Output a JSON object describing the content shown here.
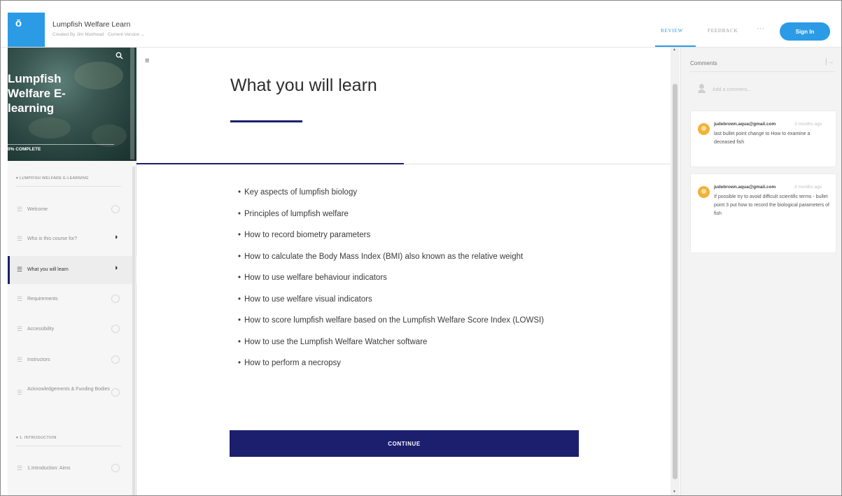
{
  "header": {
    "logo_glyph": "ō",
    "course_title": "Lumpfish Welfare Learn",
    "course_subtitle": "Created By Jim Muirhead · Current Version ⌄",
    "nav": {
      "review": "REVIEW",
      "feedback": "FEEDBACK",
      "more": "···"
    },
    "signin_label": "Sign In"
  },
  "sidebar": {
    "hero_title": "Lumpfish Welfare E-learning",
    "progress_label": "0% COMPLETE",
    "progress_percent": 0,
    "search_icon": "search-icon",
    "sections": [
      {
        "title": "▾ LUMPFISH WELFARE E-LEARNING",
        "items": [
          {
            "label": "Welcome",
            "status": "not-started"
          },
          {
            "label": "Who is this course for?",
            "status": "in-progress"
          },
          {
            "label": "What you will learn",
            "status": "in-progress",
            "active": true
          },
          {
            "label": "Requirements",
            "status": "not-started"
          },
          {
            "label": "Accessibility",
            "status": "not-started"
          },
          {
            "label": "Instructors",
            "status": "not-started"
          },
          {
            "label": "Acknowledgements & Funding Bodies",
            "status": "not-started"
          }
        ]
      },
      {
        "title": "▾ 1. INTRODUCTION",
        "items": [
          {
            "label": "1.Introduction: Aims",
            "status": "not-started"
          }
        ]
      }
    ]
  },
  "main": {
    "menu_icon": "menu-icon",
    "lesson_title": "What you will learn",
    "bullets": [
      "Key aspects of lumpfish biology",
      "Principles of lumpfish welfare",
      "How to record biometry parameters",
      "How to calculate the Body Mass Index (BMI) also known as the relative weight",
      "How to use welfare behaviour indicators",
      "How to use welfare visual indicators",
      "How to score lumpfish welfare based on the Lumpfish Welfare Score Index (LOWSI)",
      "How to use the Lumpfish Welfare Watcher software",
      "How to perform a necropsy"
    ],
    "continue_label": "CONTINUE"
  },
  "comments": {
    "title": "Comments",
    "add_placeholder": "Add a comment...",
    "items": [
      {
        "author": "judebrown.aqua@gmail.com",
        "time": "3 months ago",
        "text": "last bullet point change to How to examine a deceased fish"
      },
      {
        "author": "judebrown.aqua@gmail.com",
        "time": "3 months ago",
        "text": "If possible try to avoid difficult scientific terms - bullet point 3 put how to record the biological parameters of fish"
      }
    ]
  },
  "colors": {
    "brand_blue": "#2b9be6",
    "navy": "#1b1f6e",
    "avatar_orange": "#f2b23a"
  }
}
